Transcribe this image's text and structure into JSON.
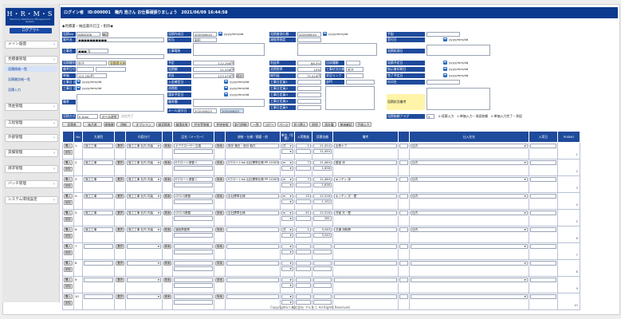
{
  "logo": {
    "mark": "H・R・M・S",
    "sub": "Harmony Residence Management System"
  },
  "sidebar": {
    "logout": "ログアウト",
    "items": [
      "メイン画面",
      "見積書管理",
      "現金管理",
      "工程管理",
      "外部管理",
      "実績管理",
      "請求管理",
      "バッチ管理",
      "システム環境設定"
    ],
    "subs": [
      "見積情報一覧",
      "見積書詳細一覧",
      "見積入力"
    ]
  },
  "topbar": {
    "text": "ログイン者　ID:000001　権内 浩さん お仕事頑張りましょう　2021/06/09 16:44:58"
  },
  "breadcrumb": "◆見積書・納品書の訂正・削除◆",
  "labels": {
    "l1": [
      "見積No",
      "案件名",
      "",
      "工事名",
      "",
      "見積種別名",
      "備考日付",
      "単価",
      "工事日 自",
      "工事日 至",
      "",
      "備考"
    ],
    "l2": [
      "見積作成日",
      "担当",
      "工事場所",
      "",
      "予定",
      "見積額",
      "合計",
      "入金確定日",
      "消費税",
      "請求予定日",
      "備考欄",
      "メール送付日"
    ],
    "l3": [
      "見積書発行数",
      "諸経費指定",
      "",
      "",
      "利益率",
      "消費税率",
      "総利益",
      "工事日定員1",
      "工事日定員2",
      "工事日定員3",
      "工事日定員4",
      "工事日定員5"
    ],
    "l4": [
      "回収種類",
      "工事状況分類",
      "状況ランク",
      "",
      "部門",
      "",
      "",
      "",
      "",
      "",
      "",
      "",
      ""
    ],
    "l5": [
      "手配",
      "受付日",
      "見積処理日",
      "見積予定日",
      "指示書印刷日",
      "完了予定日",
      "社印名",
      "",
      "見積状況備考"
    ]
  },
  "values": {
    "a1": "A004100",
    "a2": "■■■■■■■■■■",
    "a3": "■■",
    "a4": "■■■ 号",
    "b1": "2020/08/10",
    "b2": "岡田",
    "b3": "",
    "c1": "2020/08/10",
    "c2": "",
    "yyyy": "yyyy/mm/dd",
    "price1": "112,290円",
    "price2": "11,229円",
    "price3": "123,475円",
    "rate1": "88.5%",
    "rate2": "10%",
    "rate3": "75,019円",
    "status": "見積提出済",
    "kind": "外注",
    "m1": "E-mail",
    "m2": "メール送信",
    "m3": "送信完了",
    "flag": "0",
    "flagnote": "0:見積入力　1:単価入力・承認依頼　2:単価入力完了・承認",
    "date2": "2020/08/25",
    "date3": "2020/08/25"
  },
  "buttons": {
    "b": [
      "見積書",
      "納品書",
      "連携番",
      "明細",
      "オプション",
      "御見積書",
      "御請求書",
      "代金受領書",
      "控除参照",
      "取引明細",
      "一覧",
      "コピー",
      "ページ",
      "並べ替え",
      "削除",
      "再計算",
      "単価確認",
      "目錄入力"
    ]
  },
  "toolbar": {
    "label": "見積方式",
    "reason": "見積依頼フラグ"
  },
  "table": {
    "headers": [
      "",
      "No",
      "大項目",
      "",
      "内容分け",
      "",
      "品名（メーカー）",
      "",
      "規格・仕様／摘要・他",
      "単位（号数）",
      "入荷数量",
      "見積金額",
      "備考",
      "",
      "仕入先名",
      "入荷日",
      "POSNO"
    ],
    "headers2": [
      "",
      "",
      "",
      "",
      "",
      "",
      "",
      "",
      "",
      "",
      "見積単価",
      "見積原価",
      "",
      "見積",
      "",
      "",
      ""
    ],
    "action1": "購入",
    "action2": "削除",
    "pick": "選択",
    "search": "検索",
    "rows": [
      {
        "no": "1",
        "big": "施工工事",
        "cat": "施工工事 社内 内装",
        "name": "ドアクローザー交換",
        "spec": "既存 撤去・設計 取付",
        "unit": "式",
        "qty": "1",
        "amt": "11,454",
        "amt2": "11,454",
        "note": "出費ドア",
        "sup": "社内",
        "pos": "1"
      },
      {
        "no": "2",
        "big": "施工工事",
        "cat": "施工工事 社内 内装",
        "name": "Eクロート張替 C",
        "spec": "Sクロートtsk 出社標準仕様 PP-10163",
        "unit": "m",
        "qty": "7",
        "amt": "11,464",
        "amt2": "1,638",
        "note": "寝室 床",
        "sup": "社内",
        "pos": "2"
      },
      {
        "no": "3",
        "big": "施工工事",
        "cat": "施工工事 社内 内装",
        "name": "Eクロート張替 C",
        "spec": "Sクロートtsk 出社標準仕様 PP-10163",
        "unit": "m",
        "qty": "7",
        "amt": "11,464",
        "amt2": "1,638",
        "note": "キッチン 床",
        "sup": "社内",
        "pos": "3"
      },
      {
        "no": "4",
        "big": "施工工事",
        "cat": "施工工事 社内 内装",
        "name": "CFCCS張替",
        "spec": "出社標準仕様",
        "unit": "m",
        "qty": "10",
        "amt": "11,516",
        "amt2": "1,152",
        "note": "キッチン 天・壁",
        "sup": "社内",
        "pos": "4"
      },
      {
        "no": "5",
        "big": "施工工事",
        "cat": "施工工事 社内 内装",
        "name": "CFCCS張替",
        "spec": "出社標準仕様",
        "unit": "m",
        "qty": "41",
        "amt": "11,516",
        "amt2": "281",
        "note": "洋室 天・壁",
        "sup": "社内",
        "pos": "5"
      },
      {
        "no": "6",
        "big": "施工工事",
        "cat": "施工工事 社内 内装",
        "name": "諸経費雑費",
        "spec": "",
        "unit": "式",
        "qty": "1",
        "amt": "3,240",
        "amt2": "3,240",
        "note": "交通 消耗費",
        "sup": "社内",
        "pos": "6"
      },
      {
        "no": "7",
        "big": "",
        "cat": "",
        "name": "",
        "spec": "",
        "unit": "",
        "qty": "",
        "amt": "",
        "amt2": "",
        "note": "",
        "sup": "",
        "pos": "7"
      },
      {
        "no": "8",
        "big": "",
        "cat": "",
        "name": "",
        "spec": "",
        "unit": "",
        "qty": "",
        "amt": "",
        "amt2": "",
        "note": "",
        "sup": "",
        "pos": "8"
      },
      {
        "no": "9",
        "big": "",
        "cat": "",
        "name": "",
        "spec": "",
        "unit": "",
        "qty": "",
        "amt": "",
        "amt2": "",
        "note": "",
        "sup": "",
        "pos": "9"
      },
      {
        "no": "10",
        "big": "",
        "cat": "",
        "name": "",
        "spec": "",
        "unit": "",
        "qty": "",
        "amt": "",
        "amt2": "",
        "note": "",
        "sup": "",
        "pos": "10"
      }
    ]
  },
  "footer": "Copyright(c) 株式会社 アルモニ All Rights Reserved."
}
